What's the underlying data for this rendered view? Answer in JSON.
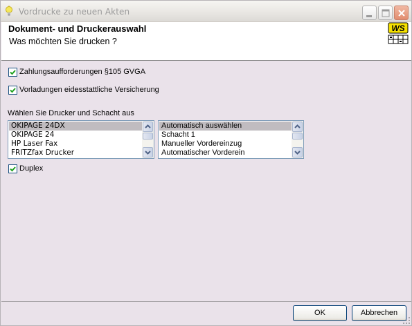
{
  "window": {
    "title": "Vordrucke zu neuen Akten",
    "controls": [
      "minimize",
      "maximize",
      "close"
    ],
    "icon": "lightbulb-icon",
    "close_color": "#e28d6f"
  },
  "header": {
    "heading": "Dokument- und Druckerauswahl",
    "question": "Was möchten Sie drucken ?",
    "logo_text": "WS",
    "logo_color": "#f5e100"
  },
  "options": {
    "zahlungsaufforderungen": {
      "label": "Zahlungsaufforderungen §105 GVGA",
      "checked": true
    },
    "vorladungen": {
      "label": "Vorladungen eidesstattliche Versicherung",
      "checked": true
    }
  },
  "printer_section": {
    "label": "Wählen Sie Drucker und Schacht aus",
    "printers": {
      "items": [
        "OKIPAGE 24DX",
        "OKIPAGE 24",
        "HP Laser Fax",
        "FRITZfax Drucker"
      ],
      "selected": "OKIPAGE 24DX"
    },
    "trays": {
      "items": [
        "Automatisch auswählen",
        "Schacht 1",
        "Manueller Vordereinzug",
        "Automatischer Vorderein"
      ],
      "selected": "Automatisch auswählen"
    }
  },
  "duplex": {
    "label": "Duplex",
    "checked": true
  },
  "buttons": {
    "ok": "OK",
    "cancel": "Abbrechen"
  },
  "colors": {
    "background": "#eae2ea",
    "selection": "#c0bcc0",
    "check": "#21a121"
  }
}
